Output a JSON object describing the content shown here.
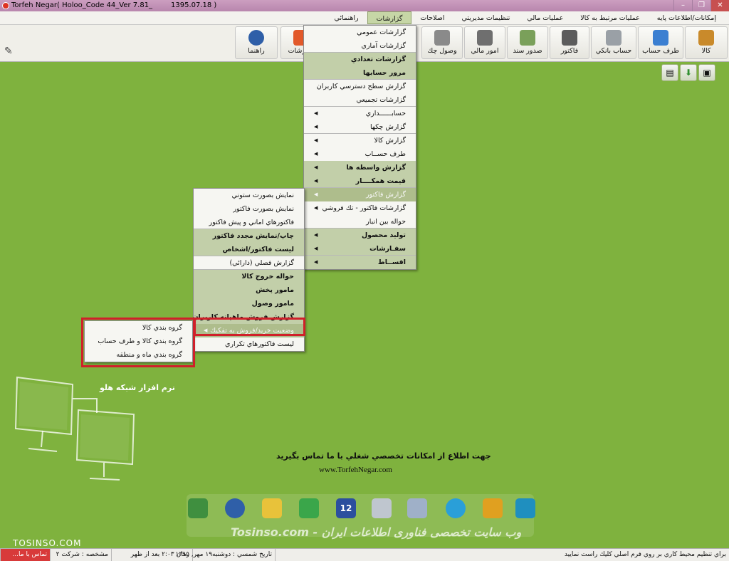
{
  "window": {
    "title": "Torfeh Negar( Holoo_Code 44_Ver 7.81_",
    "date": "1395.07.18 )",
    "buttons": [
      "–",
      "❐",
      "✕"
    ]
  },
  "menubar": [
    {
      "label": "إمکانات/اطلاعات پایه"
    },
    {
      "label": "عمليات مرتبط به کالا"
    },
    {
      "label": "عمليات مالي"
    },
    {
      "label": "تنظيمات مديريتي"
    },
    {
      "label": "اصلاحات"
    },
    {
      "label": "گزارشات",
      "active": true
    },
    {
      "label": "راهنمائي"
    }
  ],
  "toolbar": [
    {
      "label": "کالا",
      "icon": "box-icon",
      "color": "#c98a2b"
    },
    {
      "label": "طرف حساب",
      "icon": "person-icon",
      "color": "#3b7fd1"
    },
    {
      "label": "حساب بانکي",
      "icon": "bank-card-icon",
      "color": "#9aa0a6"
    },
    {
      "label": "فاکتور",
      "icon": "calculator-icon",
      "color": "#5c5c5c"
    },
    {
      "label": "صدور سند",
      "icon": "document-pen-icon",
      "color": "#7aa05a"
    },
    {
      "label": "امور مالي",
      "icon": "calculator-small-icon",
      "color": "#6f6f6f"
    },
    {
      "label": "وصول چك",
      "icon": "check-icon",
      "color": "#8a8a8a"
    },
    {
      "label": "گزارشات",
      "icon": "pie-chart-icon",
      "color": "#e2592a"
    },
    {
      "label": "راهنما",
      "icon": "help-icon",
      "color": "#2f5fa8"
    }
  ],
  "reports_menu": [
    {
      "label": "گزارشات عمومي"
    },
    {
      "label": "گزارشات آماري",
      "sep": true
    },
    {
      "label": "گزارشات تعدادي",
      "bold": true
    },
    {
      "label": "مرور حسابها",
      "bold": true,
      "sep": true
    },
    {
      "label": "گزارش سطح دسترسي کاربران"
    },
    {
      "label": "گزارشات تجميعي",
      "sep": true
    },
    {
      "label": "حسابــــــداري",
      "arrow": true
    },
    {
      "label": "گزارش چکها",
      "arrow": true,
      "sep": true
    },
    {
      "label": "گزارش کالا",
      "arrow": true
    },
    {
      "label": "طرف حســاب",
      "arrow": true
    },
    {
      "label": "گزارش واسطه ها",
      "arrow": true,
      "bold": true
    },
    {
      "label": "قيمت همکــــار",
      "arrow": true,
      "bold": true,
      "sep": true
    },
    {
      "label": "گزارش فاكتور",
      "arrow": true,
      "highlight": true
    },
    {
      "label": "گزارشات فاکتور - تك فروشي",
      "arrow": true
    },
    {
      "label": "حواله بين انبار",
      "sep": true
    },
    {
      "label": "توليد محصول",
      "arrow": true,
      "bold": true
    },
    {
      "label": "سفـارشات",
      "arrow": true,
      "bold": true,
      "sep": true
    },
    {
      "label": "اقســاط",
      "arrow": true,
      "bold": true
    }
  ],
  "invoice_menu": [
    {
      "label": "نمايش بصورت ستوني"
    },
    {
      "label": "نمايش بصورت فاكتور"
    },
    {
      "label": "فاکتورهاي اماني و پيش فاکتور",
      "sep": true
    },
    {
      "label": "چاپ/نمايش مجدد فاكتور",
      "bold": true
    },
    {
      "label": "ليست فاكتور/اشخاص",
      "bold": true,
      "sep": true
    },
    {
      "label": "گزارش فصلي (دارائي)",
      "sep": true
    },
    {
      "label": "حواله خروج کالا",
      "bold": true
    },
    {
      "label": "مامور پخش",
      "bold": true
    },
    {
      "label": "مامور وصول",
      "bold": true
    },
    {
      "label": "گزارش فروش ماهيانه کاربران",
      "bold": true
    },
    {
      "label": "وضعيت خريد/فروش به تفکيك",
      "arrow": true,
      "highlight": true
    },
    {
      "label": "ليست فاکتورهاي تکراري"
    }
  ],
  "group_menu": [
    {
      "label": "گروه بندي کالا"
    },
    {
      "label": "گروه بندي کالا و طرف حساب"
    },
    {
      "label": "گروه بندي ماه و منطقه"
    }
  ],
  "desktop": {
    "brand": "نرم افزار شبکه هلو",
    "contact_text": "جهت اطلاع از امکانات تخصصي شغلي با ما تماس بگيريد",
    "website": "www.TorfehNegar.com",
    "watermark": "Tosinso.com - وب سایت تخصصی فناوری اطلاعات ایران",
    "corner_mark": "TOSINSO.COM"
  },
  "dock": [
    {
      "icon": "exit-door-icon",
      "color": "#3f8f3f"
    },
    {
      "icon": "help-icon",
      "color": "#2f5fa8"
    },
    {
      "icon": "weather-icon",
      "color": "#e8c23a"
    },
    {
      "icon": "phone-icon",
      "color": "#3aa64a"
    },
    {
      "icon": "calendar-icon",
      "color": "#2b4f9e",
      "text": "12"
    },
    {
      "icon": "calculator-icon",
      "color": "#bfc6cf"
    },
    {
      "icon": "notepad-icon",
      "color": "#9fb0c8"
    },
    {
      "icon": "telegram-icon",
      "color": "#2a9fd8"
    },
    {
      "icon": "network-icon",
      "color": "#e0a020"
    },
    {
      "icon": "logo-icon",
      "color": "#1f8fbf"
    }
  ],
  "statusbar": {
    "hint": "براي تنظيم محيط کاري بر روي فرم اصلي کليك راست نماييد",
    "date": "تاريخ شمسي : دوشنبه۱۹ مهر, ۱۳۹۵",
    "time": "زمان ۲:۰۳ بعد از ظهر",
    "company": "مشخصه : شرکت ۲",
    "contact": "تماس با ما..."
  }
}
